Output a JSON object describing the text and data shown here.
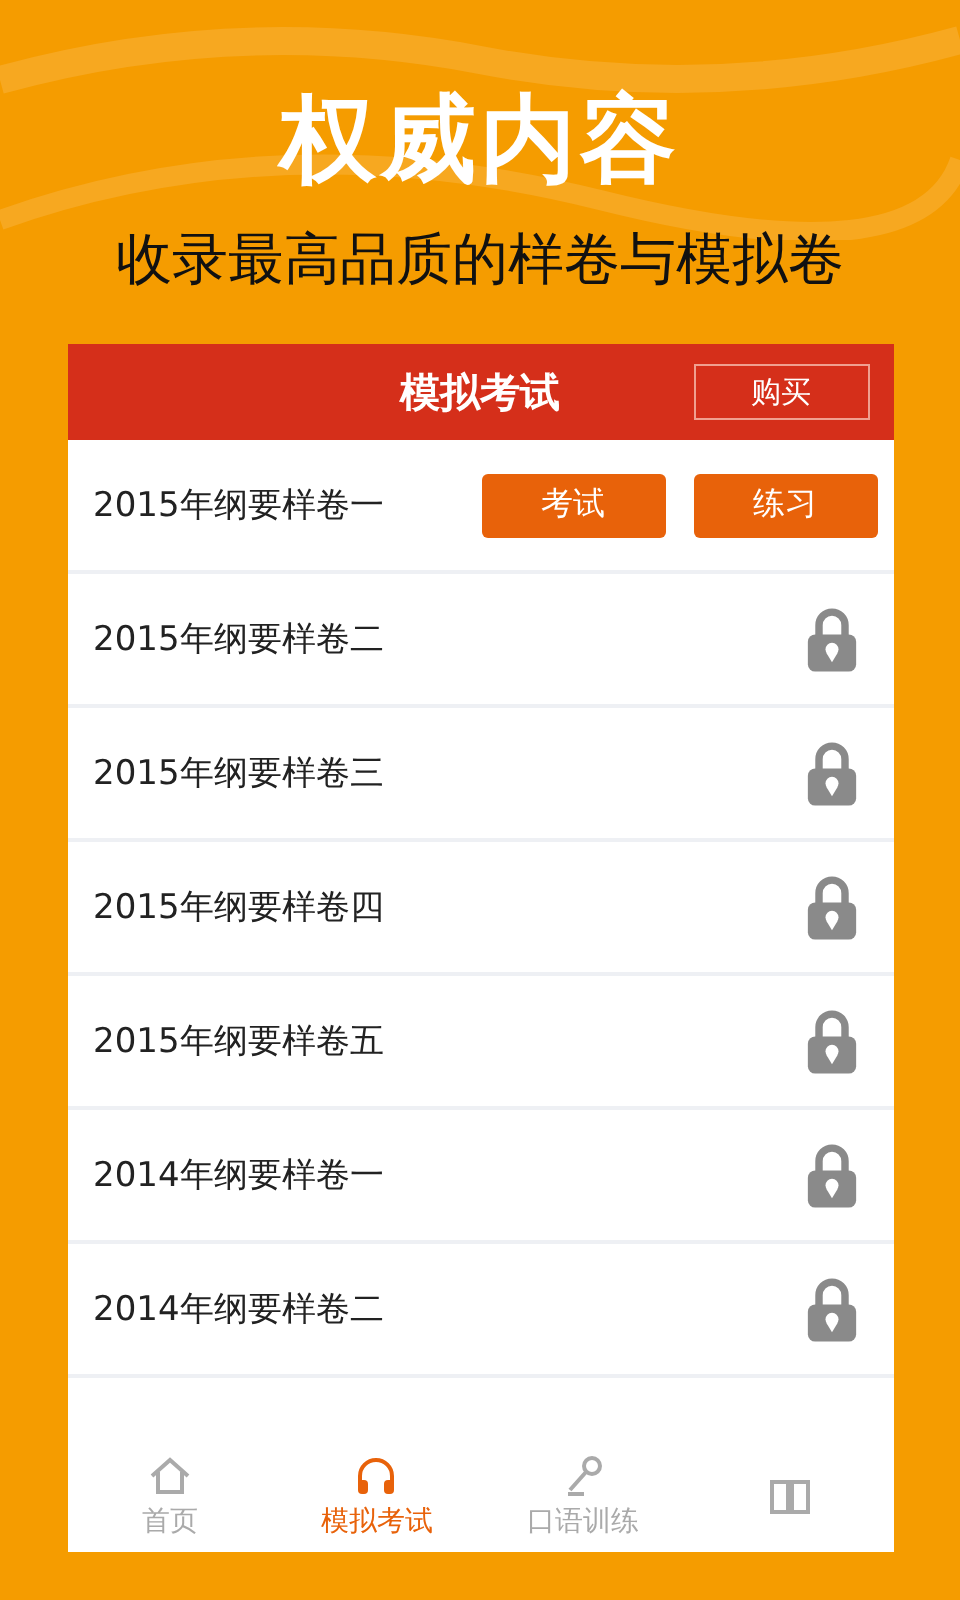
{
  "headline": "权威内容",
  "subtitle": "收录最高品质的样卷与模拟卷",
  "header": {
    "title": "模拟考试",
    "buy_button": "购买"
  },
  "papers": [
    {
      "name": "2015年纲要样卷一",
      "kind": "actions",
      "buttons": [
        "考试",
        "练习"
      ]
    },
    {
      "name": "2015年纲要样卷二",
      "kind": "locked"
    },
    {
      "name": "2015年纲要样卷三",
      "kind": "locked"
    },
    {
      "name": "2015年纲要样卷四",
      "kind": "locked"
    },
    {
      "name": "2015年纲要样卷五",
      "kind": "locked"
    },
    {
      "name": "2014年纲要样卷一",
      "kind": "locked"
    },
    {
      "name": "2014年纲要样卷二",
      "kind": "locked"
    }
  ],
  "tabs": [
    {
      "label": "首页",
      "kind": "home",
      "selected": false
    },
    {
      "label": "模拟考试",
      "kind": "headphones",
      "selected": true
    },
    {
      "label": "口语训练",
      "kind": "microphone",
      "selected": false
    },
    {
      "kind": "book",
      "selected": false
    }
  ]
}
